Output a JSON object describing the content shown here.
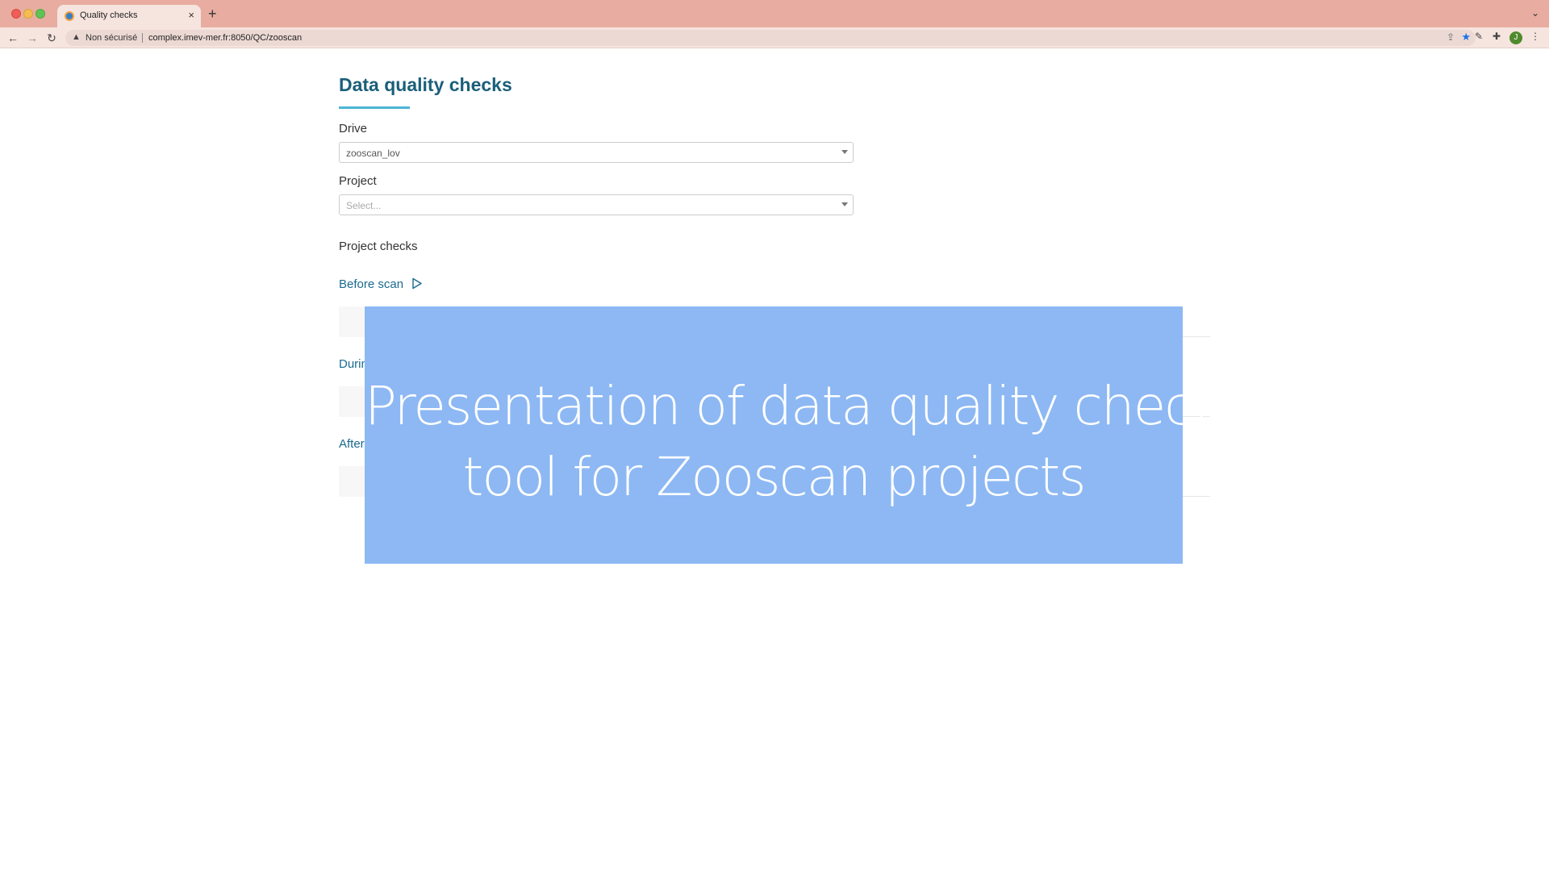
{
  "browser": {
    "tab_title": "Quality checks",
    "tab_close": "×",
    "new_tab": "+",
    "security_label": "Non sécurisé",
    "url": "complex.imev-mer.fr:8050/QC/zooscan",
    "profile_initial": "J"
  },
  "page": {
    "title": "Data quality checks",
    "drive": {
      "label": "Drive",
      "value": "zooscan_lov"
    },
    "project": {
      "label": "Project",
      "placeholder": "Select..."
    },
    "project_checks_label": "Project checks",
    "sections": [
      {
        "label": "Before scan"
      },
      {
        "label": "Durin"
      },
      {
        "label": "After"
      }
    ]
  },
  "banner": {
    "line1": "Presentation of data quality checker",
    "line2": "tool for Zooscan projects",
    "color": "#8db8f3"
  },
  "colors": {
    "tabstrip": "#e8ada0",
    "accent": "#1a5f7a",
    "link": "#1a6a8f",
    "underline": "#4cb5d6"
  }
}
